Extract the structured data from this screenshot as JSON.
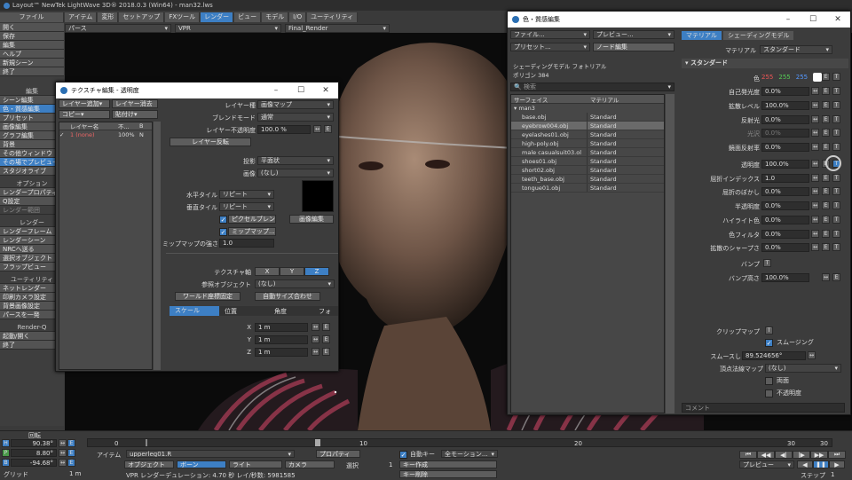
{
  "app": {
    "title": "Layout™ NewTek LightWave 3D® 2018.0.3 (Win64) - man32.lws"
  },
  "menu_tabs": [
    "ファイル",
    "アイテム",
    "変形",
    "セットアップ",
    "FXツール",
    "レンダー",
    "ビュー",
    "モデル",
    "I/O",
    "ユーティリティ"
  ],
  "sidebar": {
    "file_items": [
      "開く",
      "保存",
      "編集",
      "ヘルプ",
      "新規シーン",
      "終了"
    ],
    "file_shortcuts": [
      "N",
      "",
      ""
    ],
    "edit_header": "編集",
    "edit_items": [
      "シーン編集",
      "色・質感編集",
      "プリセット",
      "画像編集",
      "グラフ編集",
      "背景",
      "その他ウィンドウ",
      "その場でプレビュー",
      "スタジオライブ"
    ],
    "options_header": "オプション",
    "options_items": [
      "レンダープロパティ",
      "Q設定",
      "レンダー範囲"
    ],
    "render_header": "レンダー",
    "render_items": [
      "レンダーフレーム",
      "レンダーシーン",
      "NRCへ送る",
      "選択オブジェクト",
      "フラップビュー"
    ],
    "util_header": "ユーティリティ",
    "util_items": [
      "ネットレンダー",
      "印刷カメラ設定",
      "背景画像設定",
      "パースを一発"
    ],
    "renderq_header": "Render-Q",
    "renderq_items": [
      "起動/開く",
      "終了"
    ]
  },
  "viewport": {
    "view": "パース",
    "mode": "VPR",
    "camera": "Final_Render"
  },
  "texture_editor": {
    "title": "テクスチャ編集 - 透明度",
    "add_layer": "レイヤー追加",
    "remove_layer": "レイヤー消去",
    "copy": "コピー",
    "paste": "貼付け",
    "col_name": "レイヤー名",
    "col_opacity": "不...",
    "col_blend": "B",
    "layer_name": "1 (none)",
    "layer_opacity": "100%",
    "layer_blend": "N",
    "layer_type_label": "レイヤー種",
    "layer_type": "画像マップ",
    "blend_label": "ブレンドモード",
    "blend": "通常",
    "opacity_label": "レイヤー不透明度",
    "opacity": "100.0 %",
    "invert": "レイヤー反転",
    "proj_label": "投影",
    "proj": "平面状",
    "image_label": "画像",
    "image": "(なし)",
    "htile_label": "水平タイル",
    "htile": "リピート",
    "vtile_label": "垂直タイル",
    "vtile": "リピート",
    "pixel_blend": "ピクセルブレンド",
    "mipmap": "ミップマップ...",
    "image_edit": "画像編集",
    "mip_strength_label": "ミップマップの強さ",
    "mip_strength": "1.0",
    "axis_label": "テクスチャ軸",
    "axes": [
      "X",
      "Y",
      "Z"
    ],
    "ref_label": "参照オブジェクト",
    "ref": "(なし)",
    "world_coord": "ワールド座標固定",
    "auto_size": "自動サイズ合わせ",
    "tabs": [
      "スケール",
      "位置",
      "角度",
      "フォ"
    ],
    "scale_x_label": "X",
    "scale_x": "1 m",
    "scale_y_label": "Y",
    "scale_y": "1 m",
    "scale_z_label": "Z",
    "scale_z": "1 m"
  },
  "surface_editor": {
    "title": "色・質感編集",
    "file": "ファイル...",
    "preview": "プレビュー...",
    "preset": "プリセット...",
    "node_edit": "ノード編集",
    "shading_label": "シェーディングモデル",
    "shading_value": "フォトリアル",
    "polygon_label": "ポリゴン",
    "polygon_value": "384",
    "search_placeholder": "検索",
    "col_surface": "サーフェイス",
    "col_material": "マテリアル",
    "group": "man3",
    "surfaces": [
      {
        "name": "base.obj",
        "mat": "Standard"
      },
      {
        "name": "eyebrow004.obj",
        "mat": "Standard"
      },
      {
        "name": "eyelashes01.obj",
        "mat": "Standard"
      },
      {
        "name": "high-poly.obj",
        "mat": "Standard"
      },
      {
        "name": "male casualsuit03.ol",
        "mat": "Standard"
      },
      {
        "name": "shoes01.obj",
        "mat": "Standard"
      },
      {
        "name": "short02.obj",
        "mat": "Standard"
      },
      {
        "name": "teeth_base.obj",
        "mat": "Standard"
      },
      {
        "name": "tongue01.obj",
        "mat": "Standard"
      }
    ],
    "tab_material": "マテリアル",
    "tab_shading": "シェーディングモデル",
    "material_label": "マテリアル",
    "material_value": "スタンダード",
    "section": "スタンダード",
    "color_label": "色",
    "color_r": "255",
    "color_g": "255",
    "color_b": "255",
    "props": [
      {
        "label": "自己発光度",
        "value": "0.0%"
      },
      {
        "label": "拡散レベル",
        "value": "100.0%"
      },
      {
        "label": "反射光",
        "value": "0.0%"
      },
      {
        "label": "光沢",
        "value": "0.0%"
      },
      {
        "label": "鏡面反射率",
        "value": "0.0%"
      },
      {
        "label": "透明度",
        "value": "100.0%"
      },
      {
        "label": "屈折インデックス",
        "value": "1.0"
      },
      {
        "label": "屈折のぼかし",
        "value": "0.0%"
      },
      {
        "label": "半透明度",
        "value": "0.0%"
      },
      {
        "label": "ハイライト色",
        "value": "0.0%"
      },
      {
        "label": "色フィルタ",
        "value": "0.0%"
      },
      {
        "label": "拡散のシャープさ",
        "value": "0.0%"
      }
    ],
    "bump_label": "バンプ",
    "bump_height_label": "バンプ高さ",
    "bump_height": "100.0%",
    "clip_label": "クリップマップ",
    "smoothing": "スムージング",
    "smooth_threshold_label": "スムースしきい値",
    "smooth_threshold": "89.524656°",
    "vertex_normal_label": "頂点法線マップ",
    "vertex_normal": "(なし)",
    "double_sided": "両面",
    "opaque": "不透明度",
    "comment": "コメント"
  },
  "bottom": {
    "rotate_label": "回転",
    "h_value": "90.38°",
    "p_value": "8.80°",
    "b_value": "-94.68°",
    "grid_label": "グリッド",
    "grid_value": "1 m",
    "timeline_ticks": [
      "0",
      "10",
      "20",
      "30",
      "30"
    ],
    "current_frame": "0",
    "item_label": "アイテム",
    "item_value": "upperleg01.R",
    "property_label": "プロパティ",
    "auto_key": "自動キー",
    "auto_key_mode": "全モーション...",
    "select_label": "選択",
    "select_count": "1",
    "create_key": "キー作成",
    "delete_key": "キー削除",
    "object": "オブジェクト",
    "bone": "ボーン",
    "light": "ライト",
    "camera": "カメラ",
    "status": "VPR レンダーデュレーション: 4.70 秒 レイ/秒数: 5981585",
    "preview": "プレビュー",
    "step_label": "ステップ",
    "step_value": "1"
  }
}
